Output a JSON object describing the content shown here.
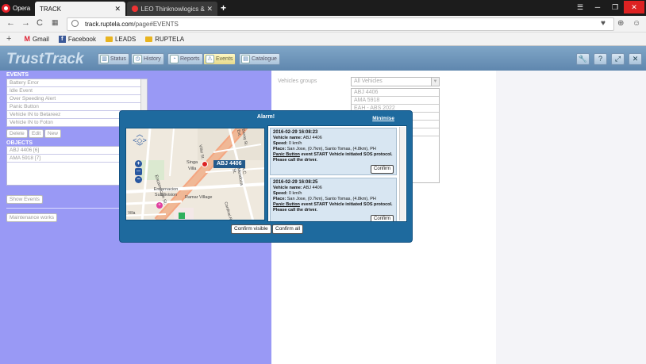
{
  "browser": {
    "menu_label": "Opera",
    "tabs": [
      {
        "label": "TRACK",
        "active": true
      },
      {
        "label": "LEO Thinknowlogics & Pa",
        "active": false
      }
    ],
    "url_host": "track.ruptela.com",
    "url_path": "/page#EVENTS",
    "bookmarks": [
      "Gmail",
      "Facebook",
      "LEADS",
      "RUPTELA"
    ]
  },
  "app": {
    "logo": "TrustTrack",
    "nav": [
      "Status",
      "History",
      "Reports",
      "Events",
      "Catalogue"
    ],
    "active_nav": "Events"
  },
  "left": {
    "events_title": "EVENTS",
    "events": [
      "Battery Error",
      "Idle Event",
      "Over Speeding Alert",
      "Panic Button",
      "Vehicle IN to Betareez",
      "Vehicle IN to Foton"
    ],
    "buttons": [
      "Delete",
      "Edit",
      "New"
    ],
    "objects_title": "OBJECTS",
    "objects": [
      "ABJ 4406 [6]",
      "AMA 5918 [7]"
    ],
    "show_events": "Show Events",
    "maintenance": "Maintenance works"
  },
  "vehicles": {
    "label": "Vehicles groups",
    "selected": "All Vehicles",
    "list": [
      "ABJ 4406",
      "AMA 5918",
      "EAH - ABS 2022",
      "",
      "",
      ""
    ]
  },
  "alarm": {
    "title": "Alarm!",
    "minimise": "Minimise",
    "map": {
      "vehicle": "ABJ 4406",
      "places": [
        "Singa",
        "Villa",
        "Encarnacion St.",
        "Encarnacion Subdivision",
        "Ramar Village",
        "A.C. Mendoza St.",
        "Cardinal Rosales St.",
        "Banay St. Ext.",
        "Villar St.",
        "Villa"
      ]
    },
    "events": [
      {
        "datetime": "2016-02-29 16:08:23",
        "vehicle_label": "Vehicle name:",
        "vehicle": "ABJ 4406",
        "speed_label": "Speed:",
        "speed": "0 km/h",
        "place_label": "Place:",
        "place": "San Jose, (0.7km), Santo Tomas, (4.8km), PH",
        "event_link": "Panic Button",
        "message": "event START Vehicle initiated SOS protocol. Please call the driver.",
        "button": "Confirm"
      },
      {
        "datetime": "2016-02-29 16:08:25",
        "vehicle_label": "Vehicle name:",
        "vehicle": "ABJ 4406",
        "speed_label": "Speed:",
        "speed": "0 km/h",
        "place_label": "Place:",
        "place": "San Jose, (0.7km), Santo Tomas, (4.8km), PH",
        "event_link": "Panic Button",
        "message": "event START Vehicle initiated SOS protocol. Please call the driver.",
        "button": "Confirm"
      }
    ],
    "confirm_visible": "Confirm visible",
    "confirm_all": "Confirm all"
  }
}
